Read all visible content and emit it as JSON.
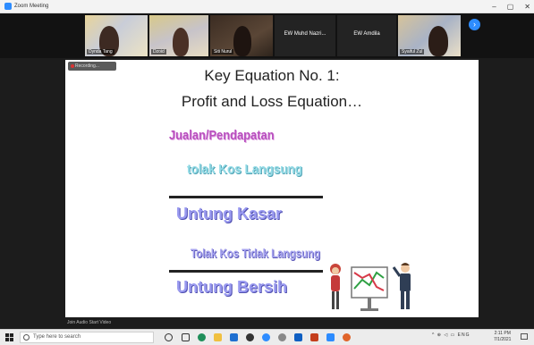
{
  "window": {
    "title": "Zoom Meeting",
    "controls": [
      "–",
      "▢",
      "✕"
    ]
  },
  "participants": [
    {
      "label": "Dynda Tang"
    },
    {
      "label": "Dzoid"
    },
    {
      "label": "Siti Nurul"
    },
    {
      "label": "EW Muhd Nazri..."
    },
    {
      "label": "EW Amdila"
    },
    {
      "label": "Syaiful Zul"
    }
  ],
  "recording_label": "Recording...",
  "slide": {
    "title_line1": "Key Equation No. 1:",
    "title_line2": "Profit and Loss Equation…",
    "wordart": [
      "Jualan/Pendapatan",
      "tolak Kos Langsung",
      "Untung Kasar",
      "Tolak Kos Tidak Langsung",
      "Untung Bersih"
    ]
  },
  "controls_bar_text": "Join Audio   Start Video",
  "taskbar": {
    "search_placeholder": "Type here to search",
    "tray_text": "^ ⊕ ◁ ▭ ENG",
    "time": "2:11 PM",
    "date": "7/1/2021"
  },
  "colors": {
    "zoom_blue": "#2d8cff",
    "wordart_pink": "#b84fbe",
    "wordart_cyan": "#93dbe6",
    "wordart_blue": "#9a9af0"
  }
}
